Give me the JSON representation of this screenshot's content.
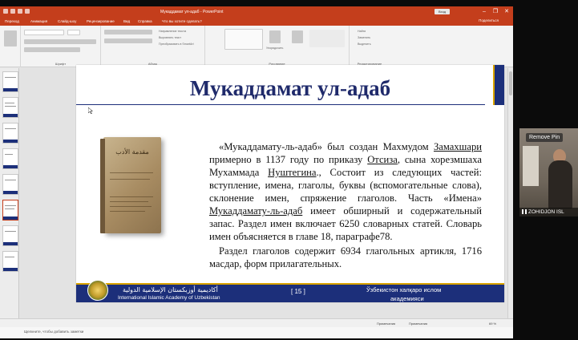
{
  "window": {
    "title": "Мукаддамат ул-адаб - PowerPoint",
    "login_button": "Вход",
    "controls": {
      "minimize": "–",
      "restore": "❐",
      "close": "✕"
    }
  },
  "ribbon_tabs": [
    "Переход",
    "Анимация",
    "Слайд-шоу",
    "Рецензирование",
    "Вид",
    "Справка",
    "Что вы хотите сделать?"
  ],
  "share_label": "Поделиться",
  "ribbon_groups": {
    "font": "Шрифт",
    "paragraph": "Абзац",
    "drawing": "Рисование",
    "editing": "Редактирование"
  },
  "ribbon_small": {
    "find": "Найти",
    "replace": "Заменить",
    "select": "Выделить",
    "arrange": "Упорядочить",
    "direction": "Направление текста",
    "align": "Выровнять текст",
    "smartart": "Преобразовать в SmartArt"
  },
  "slide": {
    "title": "Мукаддамат ул-адаб",
    "book_arabic": "مقدمة الأدب",
    "p1_a": "«Мукаддамату-ль-адаб» был создан Махмудом ",
    "p1_u1": "Замахшари",
    "p1_b": " примерно в 1137 году по приказу ",
    "p1_u2": "Отсиза",
    "p1_c": ", сына хорезмшаха Мухаммада ",
    "p1_u3": "Нуштегина",
    "p1_d": "., Состоит из следующих частей: вступление, имена, глаголы, буквы (вспомогательные слова), склонение имен, спряжение глаголов. Часть «Имена» ",
    "p1_u4": "Мукаддамату-ль-адаб",
    "p1_e": " имеет обширный и содержательный запас. Раздел имен включает 6250 словарных статей. Словарь имен объясняется в главе 18, параграфе78.",
    "p2": "Раздел глаголов содержит 6934 глагольных артикля, 1716 масдар, форм прилагательных.",
    "footer": {
      "arabic": "أكاديمية أوزبكستان الإسلامية الدولية",
      "english": "International Islamic Academy of Uzbekistan",
      "page": "[ 15 ]",
      "uz_line1": "Ўзбекистон халқаро ислом",
      "uz_line2": "академияси"
    }
  },
  "notes_placeholder": "Щелкните, чтобы добавить заметки",
  "status": {
    "notes": "Примечания",
    "comments": "Примечания",
    "zoom": "69 %"
  },
  "video": {
    "pin_label": "Remove Pin",
    "participant": "ZOHIDJON ISL"
  }
}
